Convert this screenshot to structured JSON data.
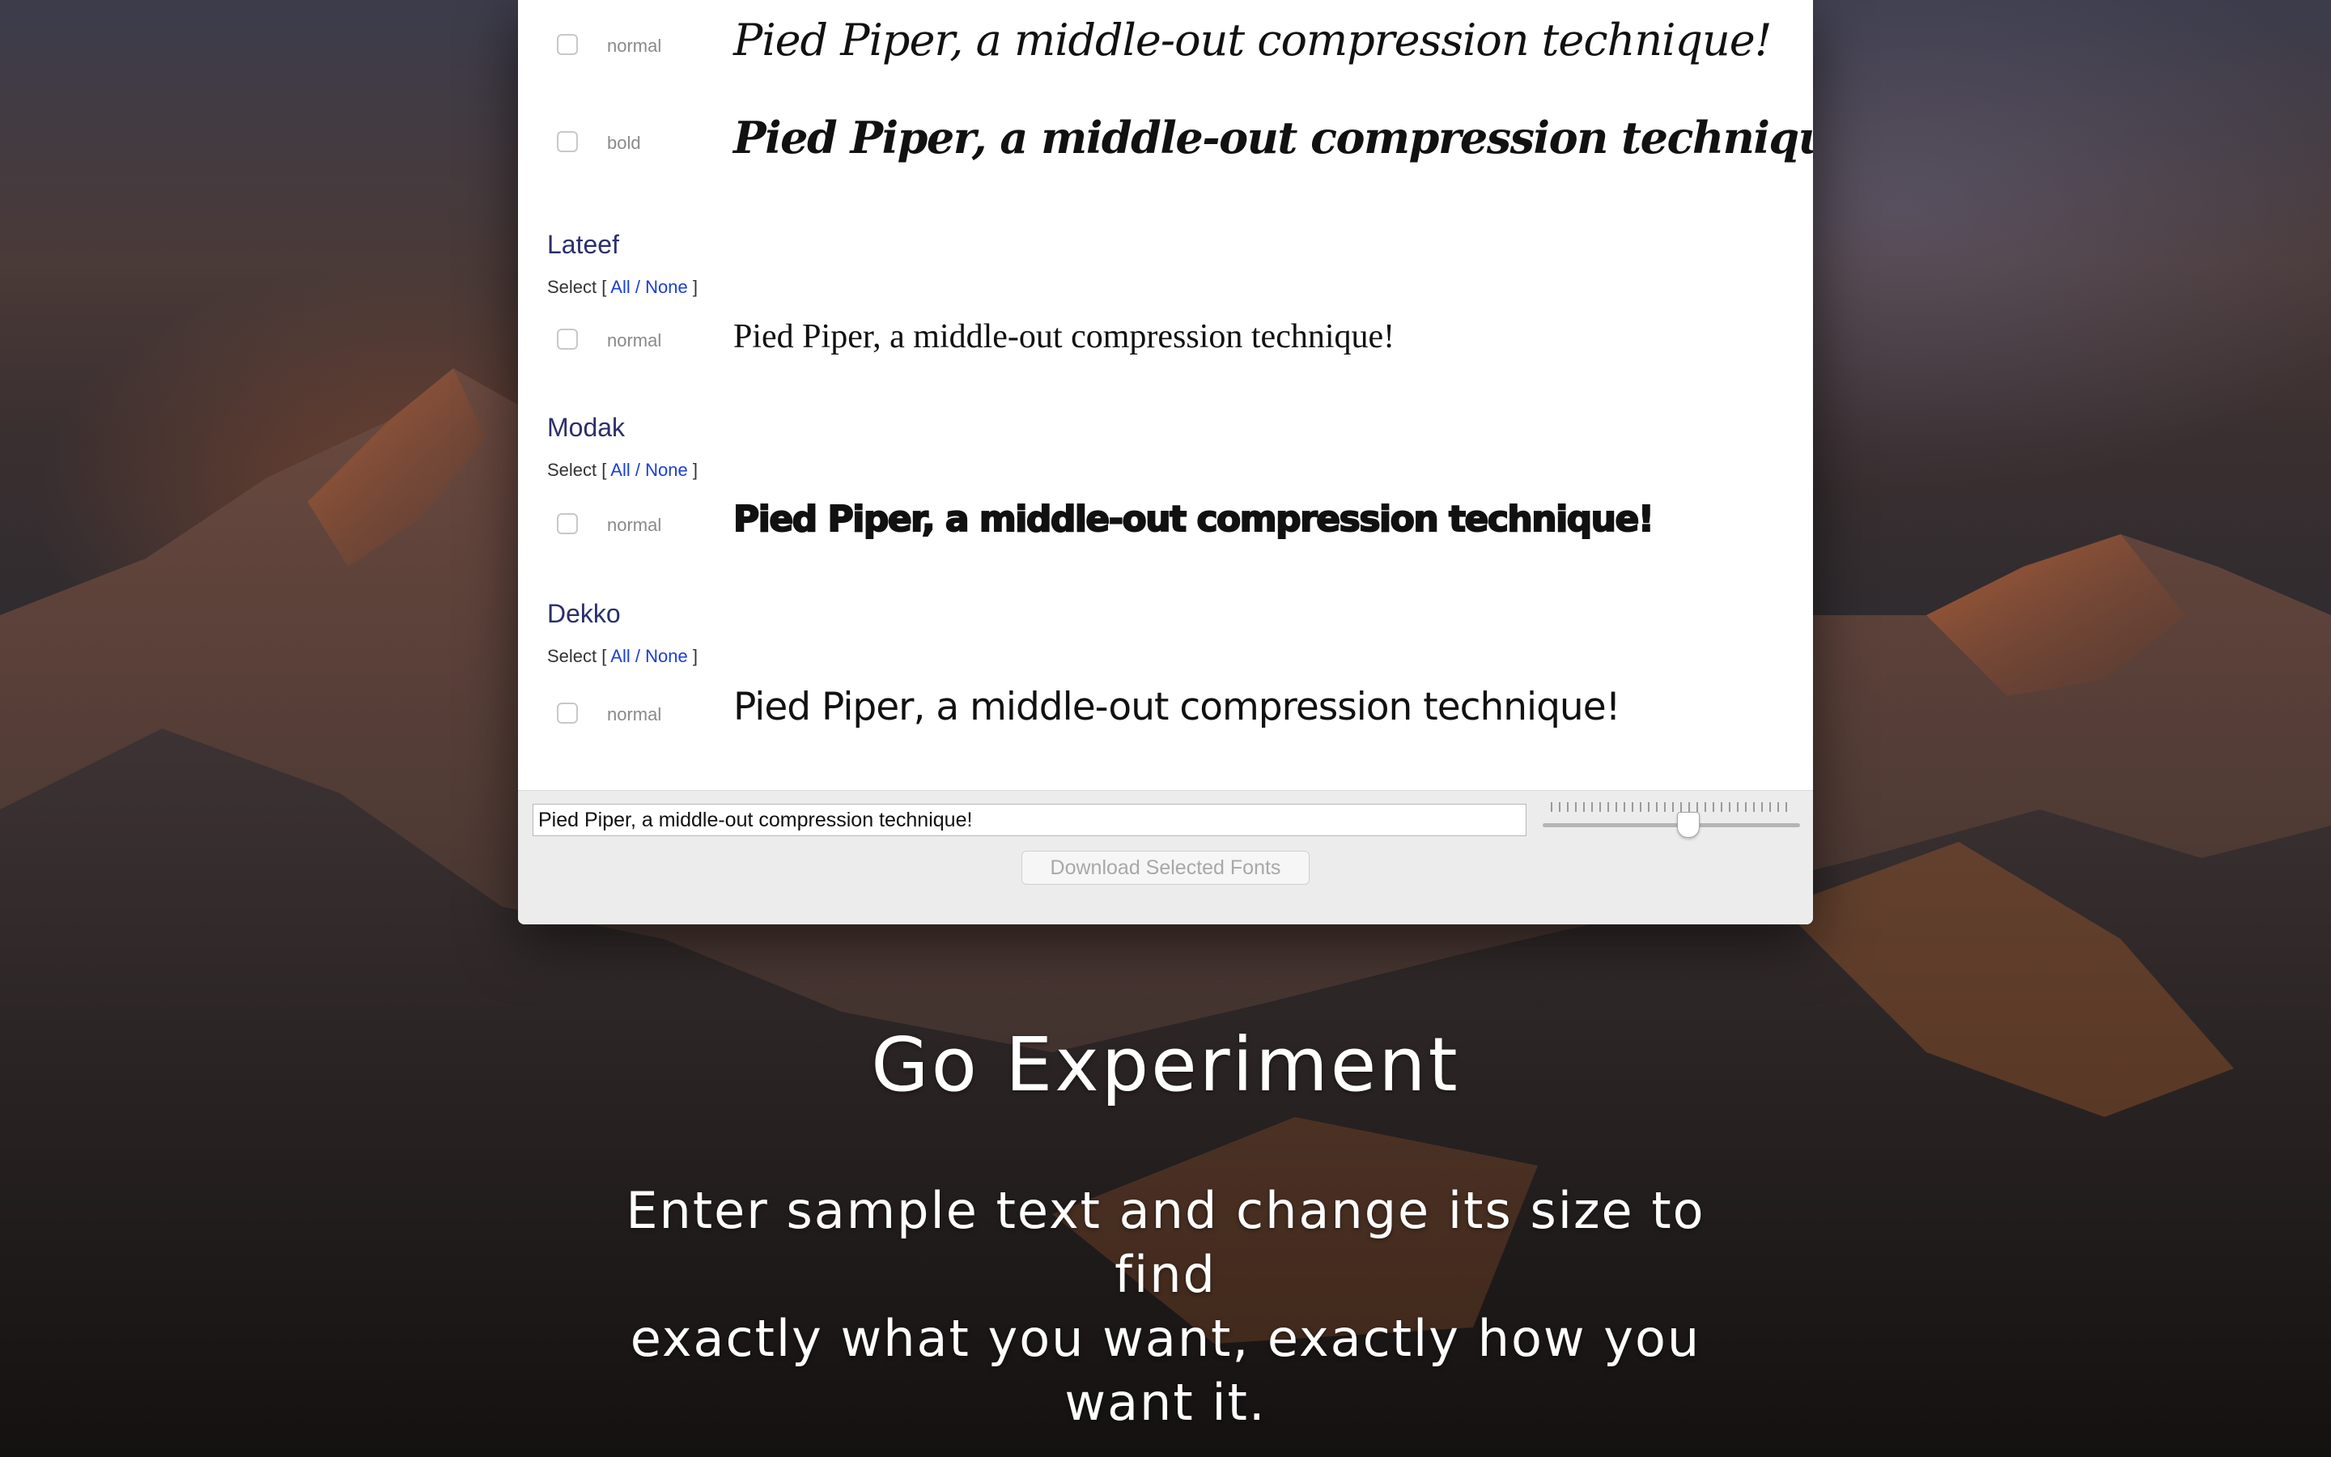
{
  "colors": {
    "family_title": "#2b2f6b",
    "link": "#1a3fd6",
    "toolbar_bg": "#ececec",
    "sample_text": "#111111",
    "promo_text": "#ffffff"
  },
  "rows_top": [
    {
      "weight": "normal",
      "sample": "Pied Piper, a middle-out compression technique!",
      "checked": false
    },
    {
      "weight": "bold",
      "sample": "Pied Piper, a middle-out compression technique!",
      "checked": false
    }
  ],
  "families": [
    {
      "name": "Lateef",
      "select_prefix": "Select [",
      "all_label": "All",
      "sep": "/",
      "none_label": "None",
      "select_suffix": "]",
      "rows": [
        {
          "weight": "normal",
          "sample": "Pied Piper, a middle-out compression technique!",
          "checked": false
        }
      ]
    },
    {
      "name": "Modak",
      "select_prefix": "Select [",
      "all_label": "All",
      "sep": "/",
      "none_label": "None",
      "select_suffix": "]",
      "rows": [
        {
          "weight": "normal",
          "sample": "Pied Piper, a middle-out compression technique!",
          "checked": false
        }
      ]
    },
    {
      "name": "Dekko",
      "select_prefix": "Select [",
      "all_label": "All",
      "sep": "/",
      "none_label": "None",
      "select_suffix": "]",
      "rows": [
        {
          "weight": "normal",
          "sample": "Pied Piper, a middle-out compression technique!",
          "checked": false
        }
      ]
    }
  ],
  "toolbar": {
    "sample_input_value": "Pied Piper, a middle-out compression technique!",
    "size_slider_fraction": 0.57,
    "download_label": "Download Selected Fonts",
    "download_enabled": false
  },
  "promo": {
    "heading": "Go Experiment",
    "line1": "Enter sample text and change its size to find",
    "line2": "exactly what you want, exactly how you",
    "line3": "want it."
  }
}
